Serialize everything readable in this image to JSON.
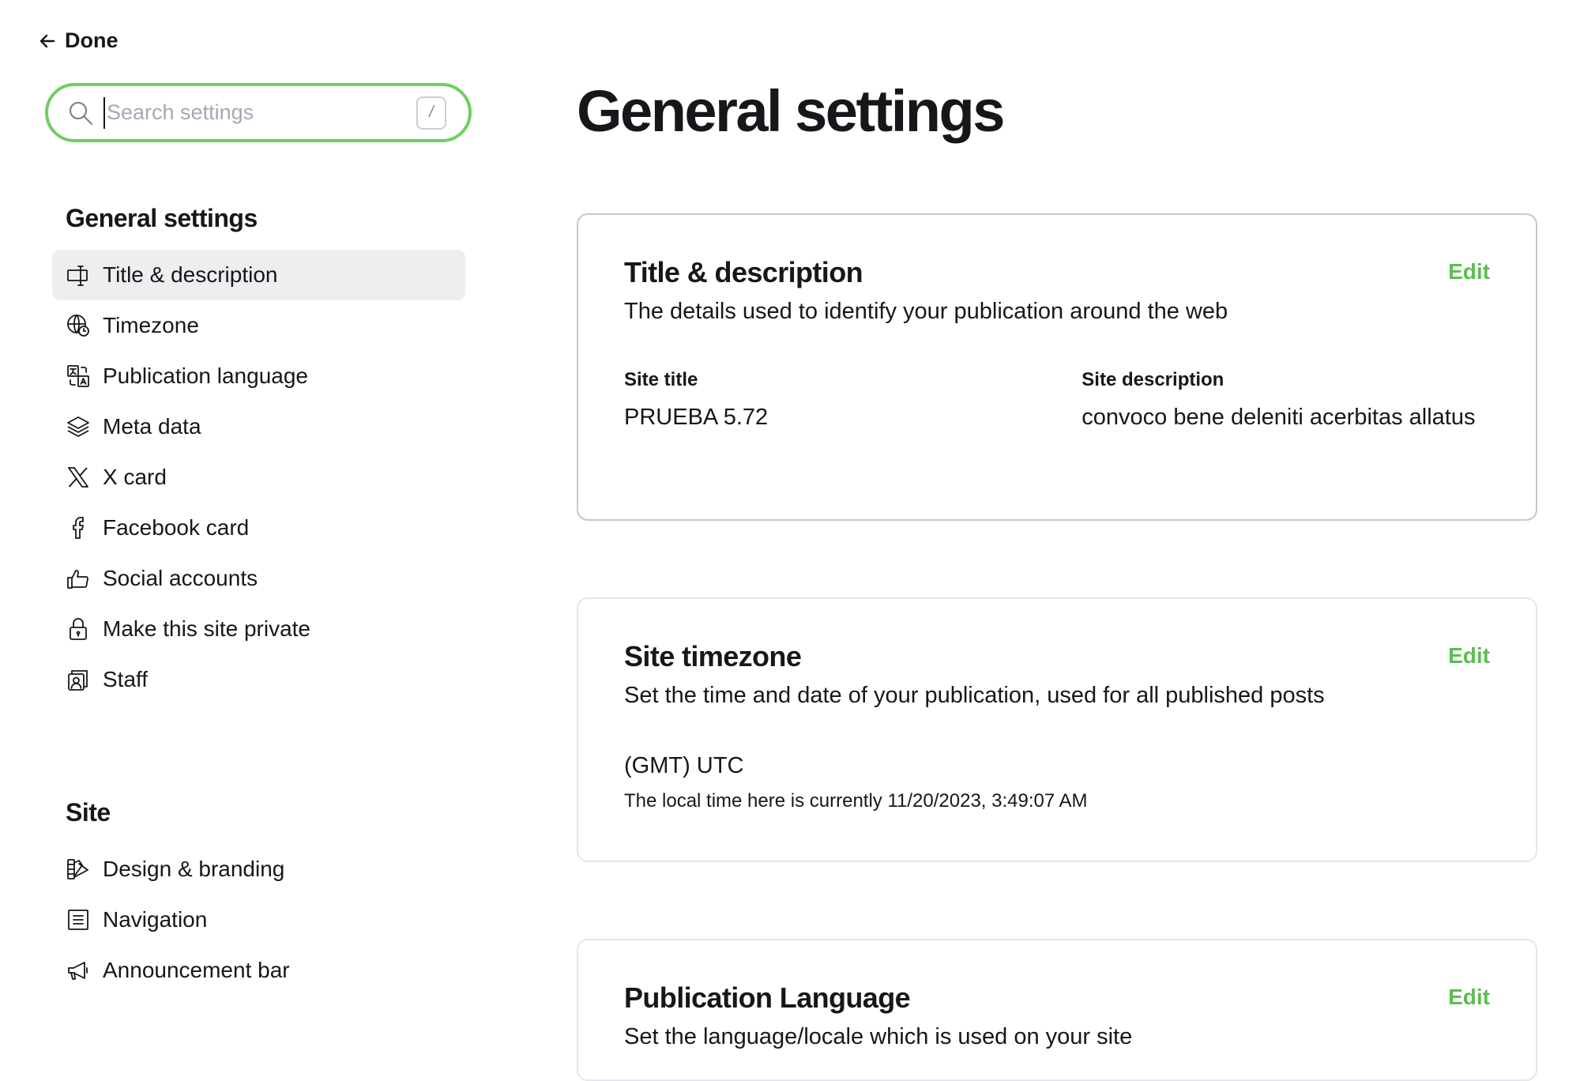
{
  "header": {
    "done_label": "Done"
  },
  "search": {
    "placeholder": "Search settings",
    "value": "",
    "shortcut": "/"
  },
  "sidebar": {
    "groups": [
      {
        "title": "General settings",
        "items": [
          {
            "label": "Title & description",
            "icon": "title-icon",
            "active": true
          },
          {
            "label": "Timezone",
            "icon": "globe-clock-icon"
          },
          {
            "label": "Publication language",
            "icon": "translate-icon"
          },
          {
            "label": "Meta data",
            "icon": "layers-icon"
          },
          {
            "label": "X card",
            "icon": "x-logo-icon"
          },
          {
            "label": "Facebook card",
            "icon": "facebook-icon"
          },
          {
            "label": "Social accounts",
            "icon": "thumbs-up-icon"
          },
          {
            "label": "Make this site private",
            "icon": "lock-icon"
          },
          {
            "label": "Staff",
            "icon": "staff-icon"
          }
        ]
      },
      {
        "title": "Site",
        "items": [
          {
            "label": "Design & branding",
            "icon": "design-icon"
          },
          {
            "label": "Navigation",
            "icon": "navigation-icon"
          },
          {
            "label": "Announcement bar",
            "icon": "megaphone-icon"
          }
        ]
      }
    ]
  },
  "main": {
    "title": "General settings",
    "edit_label": "Edit",
    "accent_color": "#5fbd52",
    "cards": {
      "title_description": {
        "title": "Title & description",
        "description": "The details used to identify your publication around the web",
        "site_title_label": "Site title",
        "site_title_value": "PRUEBA 5.72",
        "site_description_label": "Site description",
        "site_description_value": "convoco bene deleniti acerbitas allatus"
      },
      "timezone": {
        "title": "Site timezone",
        "description": "Set the time and date of your publication, used for all published posts",
        "value": "(GMT) UTC",
        "hint": "The local time here is currently 11/20/2023, 3:49:07 AM"
      },
      "language": {
        "title": "Publication Language",
        "description": "Set the language/locale which is used on your site"
      }
    }
  }
}
